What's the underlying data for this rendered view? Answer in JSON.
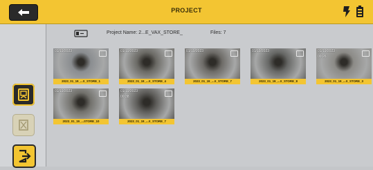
{
  "header": {
    "title": "PROJECT",
    "back_icon": "back-arrow-icon",
    "right_icons": [
      "torch-icon",
      "battery-icon"
    ],
    "accent_color": "#f3c532"
  },
  "info": {
    "project_name": "Project Name: 2...E_VAX_STORE_",
    "files_count": "Files: 7",
    "icon": "video-file-icon"
  },
  "sidebar": {
    "buttons": [
      {
        "name": "photo-view-icon",
        "state": "active"
      },
      {
        "name": "delete-icon",
        "state": "disabled"
      },
      {
        "name": "exit-icon",
        "state": "active"
      }
    ]
  },
  "files": [
    {
      "date": "01/19/2023",
      "duration": "",
      "label": "2023_01_19_...X_STORE_1",
      "tone": "#8a8d90"
    },
    {
      "date": "01/19/2023",
      "duration": "",
      "label": "2023_01_19_...X_STORE_4",
      "tone": "#6b6a65"
    },
    {
      "date": "01/19/2023",
      "duration": "",
      "label": "2023_01_19_...X_STORE_7",
      "tone": "#6e6c68"
    },
    {
      "date": "01/19/2023",
      "duration": "",
      "label": "2023_01_19_...X_STORE_8",
      "tone": "#676866"
    },
    {
      "date": "01/19/2023",
      "duration": "00:26",
      "label": "2023_01_19_...X_STORE_3",
      "tone": "#8c8b87"
    },
    {
      "date": "01/19/2023",
      "duration": "",
      "label": "2023_01_19_...STORE_10",
      "tone": "#72716c"
    },
    {
      "date": "01/19/2023",
      "duration": "00:38",
      "label": "2023_01_19_...X_STORE_7",
      "tone": "#5e5d5a"
    }
  ]
}
